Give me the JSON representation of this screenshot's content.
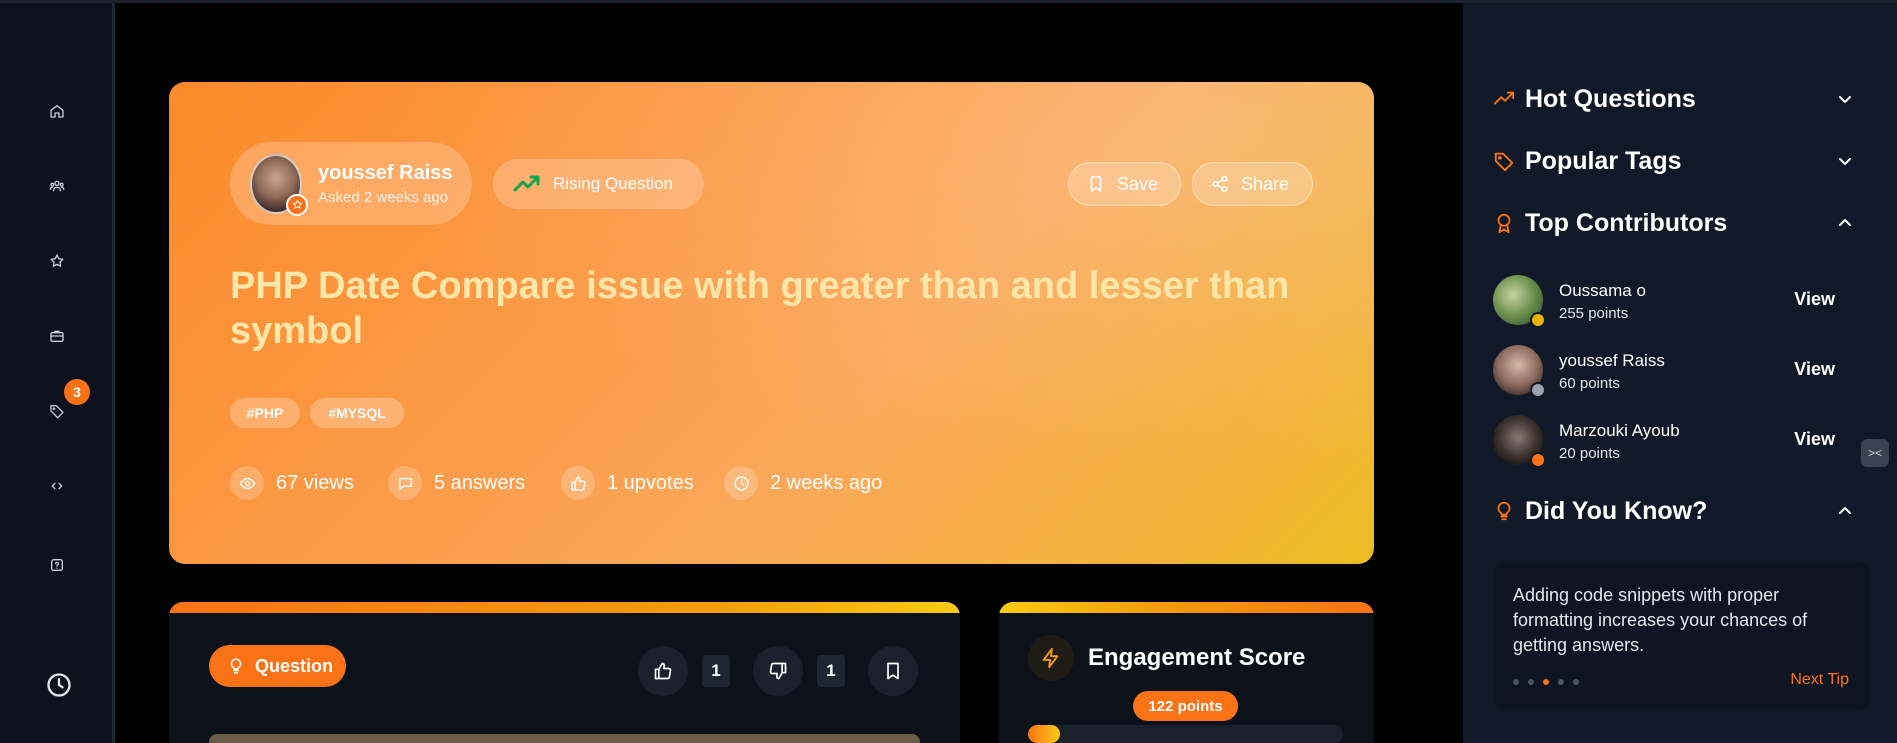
{
  "rail": {
    "badge_count": "3",
    "items": [
      {
        "icon": "home-icon"
      },
      {
        "icon": "community-icon"
      },
      {
        "icon": "star-icon"
      },
      {
        "icon": "briefcase-icon"
      },
      {
        "icon": "tag-icon"
      },
      {
        "icon": "code-icon"
      },
      {
        "icon": "question-icon"
      }
    ],
    "bottom_icon": "clock-icon"
  },
  "hero": {
    "author_name": "youssef Raiss",
    "asked_time": "Asked 2 weeks ago",
    "rising_label": "Rising Question",
    "save_label": "Save",
    "share_label": "Share",
    "title": "PHP Date Compare issue with greater than and lesser than symbol",
    "tags": [
      "#PHP",
      "#MYSQL"
    ],
    "stats": {
      "views": "67 views",
      "answers": "5 answers",
      "upvotes": "1 upvotes",
      "time": "2 weeks ago"
    }
  },
  "question_card": {
    "label": "Question",
    "upvote_count": "1",
    "downvote_count": "1"
  },
  "engagement": {
    "title": "Engagement Score",
    "points": "122 points",
    "progress_fraction": 0.1
  },
  "sidebar": {
    "hot_questions": "Hot Questions",
    "popular_tags": "Popular Tags",
    "top_contributors": "Top Contributors",
    "contributors": [
      {
        "name": "Oussama o",
        "points": "255 points",
        "view": "View",
        "status_color": "#eab308"
      },
      {
        "name": "youssef Raiss",
        "points": "60 points",
        "view": "View",
        "status_color": "#9ca3af"
      },
      {
        "name": "Marzouki Ayoub",
        "points": "20 points",
        "view": "View",
        "status_color": "#f97316"
      }
    ],
    "did_you_know": "Did You Know?",
    "tip_text": "Adding code snippets with proper formatting increases your chances of getting answers.",
    "next_tip": "Next Tip",
    "tip_dots": 5,
    "tip_active_index": 2
  },
  "colors": {
    "accent": "#f97316",
    "rising_green": "#16a34a",
    "sidebar_bg": "#111827"
  }
}
